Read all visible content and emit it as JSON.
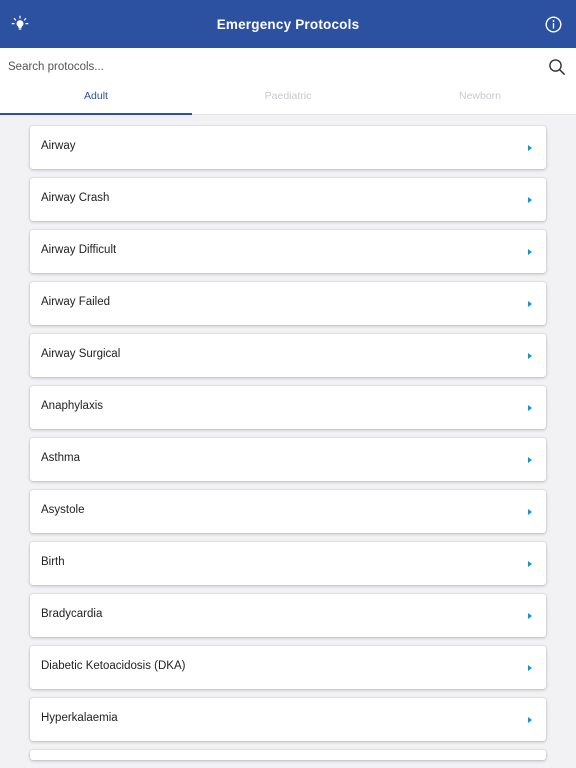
{
  "header": {
    "title": "Emergency Protocols",
    "left_icon": "lightbulb-icon",
    "right_icon": "info-icon",
    "color": "#2c51a0"
  },
  "search": {
    "placeholder": "Search protocols...",
    "value": "",
    "icon": "search-icon"
  },
  "tabs": [
    {
      "label": "Adult",
      "active": true
    },
    {
      "label": "Paediatric",
      "active": false
    },
    {
      "label": "Newborn",
      "active": false
    }
  ],
  "protocols": [
    {
      "label": "Airway"
    },
    {
      "label": "Airway Crash"
    },
    {
      "label": "Airway Difficult"
    },
    {
      "label": "Airway Failed"
    },
    {
      "label": "Airway Surgical"
    },
    {
      "label": "Anaphylaxis"
    },
    {
      "label": "Asthma"
    },
    {
      "label": "Asystole"
    },
    {
      "label": "Birth"
    },
    {
      "label": "Bradycardia"
    },
    {
      "label": "Diabetic Ketoacidosis (DKA)"
    },
    {
      "label": "Hyperkalaemia"
    }
  ],
  "accent_color": "#1a90d0"
}
